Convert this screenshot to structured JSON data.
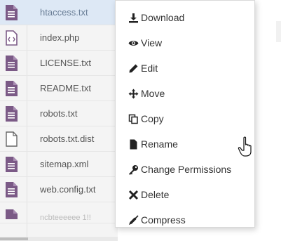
{
  "files": [
    {
      "name": "htaccess.txt",
      "icon": "text-file-icon",
      "selected": true
    },
    {
      "name": "index.php",
      "icon": "code-file-icon",
      "selected": false
    },
    {
      "name": "LICENSE.txt",
      "icon": "text-file-icon",
      "selected": false
    },
    {
      "name": "README.txt",
      "icon": "text-file-icon",
      "selected": false
    },
    {
      "name": "robots.txt",
      "icon": "text-file-icon",
      "selected": false
    },
    {
      "name": "robots.txt.dist",
      "icon": "blank-file-icon",
      "selected": false
    },
    {
      "name": "sitemap.xml",
      "icon": "text-file-icon",
      "selected": false
    },
    {
      "name": "web.config.txt",
      "icon": "text-file-icon",
      "selected": false
    },
    {
      "name": "ncbteeeeee 1!!",
      "icon": "text-file-icon",
      "selected": false
    }
  ],
  "context_menu": {
    "items": [
      {
        "label": "Download",
        "icon": "download-icon"
      },
      {
        "label": "View",
        "icon": "eye-icon"
      },
      {
        "label": "Edit",
        "icon": "pencil-icon"
      },
      {
        "label": "Move",
        "icon": "move-arrows-icon"
      },
      {
        "label": "Copy",
        "icon": "copy-icon"
      },
      {
        "label": "Rename",
        "icon": "file-icon"
      },
      {
        "label": "Change Permissions",
        "icon": "key-icon"
      },
      {
        "label": "Delete",
        "icon": "x-icon"
      },
      {
        "label": "Compress",
        "icon": "compress-icon"
      }
    ]
  },
  "colors": {
    "file_icon": "#7b5a86",
    "selected_row": "#dde8f5"
  }
}
